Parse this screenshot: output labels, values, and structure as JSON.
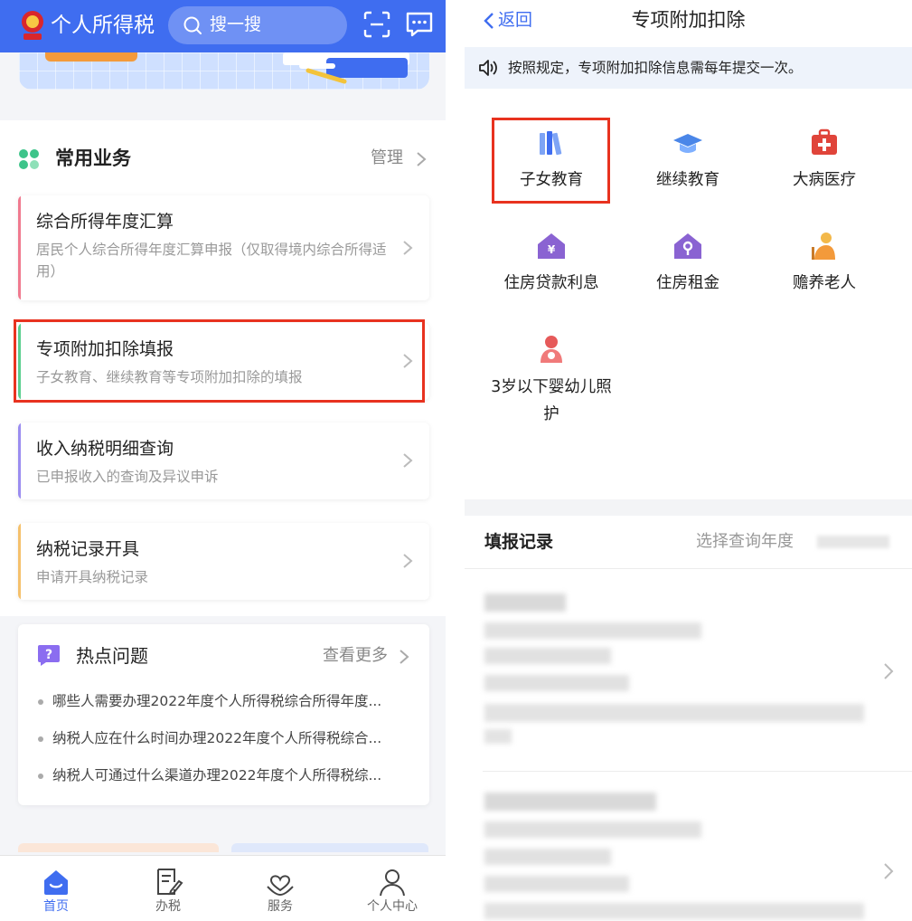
{
  "left": {
    "app_title": "个人所得税",
    "search_placeholder": "搜一搜",
    "common": {
      "title": "常用业务",
      "manage": "管理",
      "cards": [
        {
          "title": "综合所得年度汇算",
          "subtitle": "居民个人综合所得年度汇算申报（仅取得境内综合所得适用）",
          "accent": "#f07a8f"
        },
        {
          "title": "专项附加扣除填报",
          "subtitle": "子女教育、继续教育等专项附加扣除的填报",
          "accent": "#5ccf8f"
        },
        {
          "title": "收入纳税明细查询",
          "subtitle": "已申报收入的查询及异议申诉",
          "accent": "#9b8df0"
        },
        {
          "title": "纳税记录开具",
          "subtitle": "申请开具纳税记录",
          "accent": "#f5c16c"
        }
      ]
    },
    "hot": {
      "title": "热点问题",
      "more": "查看更多",
      "items": [
        "哪些人需要办理2022年度个人所得税综合所得年度...",
        "纳税人应在什么时间办理2022年度个人所得税综合...",
        "纳税人可通过什么渠道办理2022年度个人所得税综..."
      ]
    },
    "nav": [
      {
        "label": "首页",
        "icon": "home-icon",
        "active": true
      },
      {
        "label": "办税",
        "icon": "edit-document-icon",
        "active": false
      },
      {
        "label": "服务",
        "icon": "heart-hand-icon",
        "active": false
      },
      {
        "label": "个人中心",
        "icon": "user-icon",
        "active": false
      }
    ],
    "colors": {
      "brand": "#3f6df0",
      "highlight_box": "#e8321f"
    }
  },
  "right": {
    "back": "返回",
    "title": "专项附加扣除",
    "notice": "按照规定，专项附加扣除信息需每年提交一次。",
    "grid": [
      {
        "label": "子女教育",
        "icon": "books-icon"
      },
      {
        "label": "继续教育",
        "icon": "graduation-cap-icon"
      },
      {
        "label": "大病医疗",
        "icon": "medical-kit-icon"
      },
      {
        "label": "住房贷款利息",
        "icon": "house-yuan-icon"
      },
      {
        "label": "住房租金",
        "icon": "house-key-icon"
      },
      {
        "label": "赡养老人",
        "icon": "elderly-icon"
      },
      {
        "label": "3岁以下婴幼儿照护",
        "icon": "mother-baby-icon"
      }
    ],
    "records": {
      "title": "填报记录",
      "year_label": "选择查询年度"
    }
  }
}
